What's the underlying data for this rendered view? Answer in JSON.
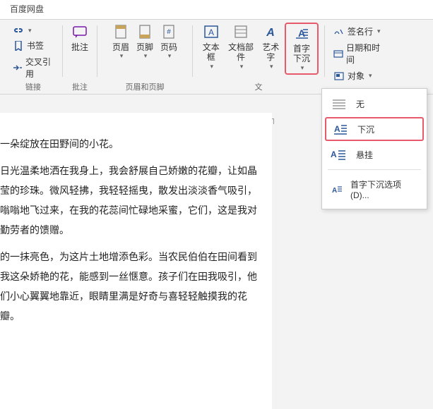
{
  "tab": {
    "name": "百度网盘"
  },
  "links_group": {
    "label": "链接",
    "bookmark": "书签",
    "xref": "交叉引用"
  },
  "anno_group": {
    "label": "批注",
    "btn": "批注"
  },
  "hf_group": {
    "label": "页眉和页脚",
    "header": "页眉",
    "footer": "页脚",
    "pagenum": "页码"
  },
  "text_group": {
    "label": "文",
    "textbox": "文本框",
    "parts": "文档部件",
    "wordart": "艺术字",
    "dropcap": "首字下沉"
  },
  "right_col": {
    "sig": "签名行",
    "datetime": "日期和时间",
    "obj": "对象"
  },
  "dropdown": {
    "none": "无",
    "drop": "下沉",
    "hang": "悬挂",
    "options": "首字下沉选项(D)..."
  },
  "doc": {
    "p1": "一朵绽放在田野间的小花。",
    "p2": "日光温柔地洒在我身上，我会舒展自己娇嫩的花瓣，让如晶莹的珍珠。微风轻拂，我轻轻摇曳，散发出淡淡香气吸引，嗡嗡地飞过来，在我的花蕊间忙碌地采蜜，它们，这是我对勤劳者的馈赠。",
    "p3": "的一抹亮色，为这片土地增添色彩。当农民伯伯在田间看到我这朵娇艳的花，能感到一丝惬意。孩子们在田我吸引，他们小心翼翼地靠近，眼睛里满是好奇与喜轻轻触摸我的花瓣。"
  }
}
